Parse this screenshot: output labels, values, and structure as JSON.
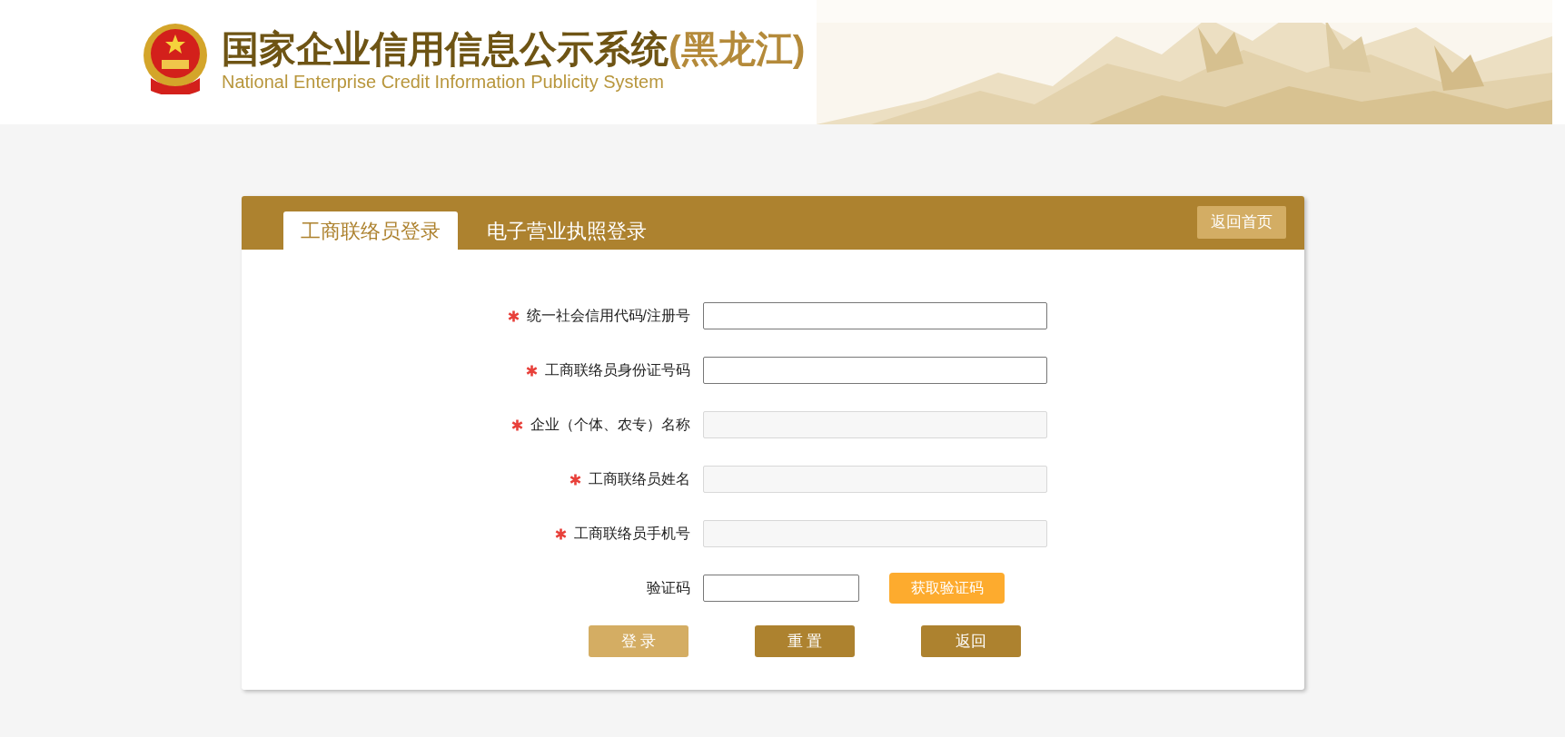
{
  "header": {
    "title": "国家企业信用信息公示系统",
    "title_suffix": "(黑龙江)",
    "subtitle": "National Enterprise Credit Information Publicity System"
  },
  "tabs": [
    {
      "label": "工商联络员登录",
      "selected": true
    },
    {
      "label": "电子营业执照登录",
      "selected": false
    }
  ],
  "home_button": "返回首页",
  "fields": [
    {
      "kind": "text",
      "label": "统一社会信用代码/注册号",
      "required": true,
      "disabled": false
    },
    {
      "kind": "text",
      "label": "工商联络员身份证号码",
      "required": true,
      "disabled": false
    },
    {
      "kind": "text",
      "label": "企业（个体、农专）名称",
      "required": true,
      "disabled": true
    },
    {
      "kind": "text",
      "label": "工商联络员姓名",
      "required": true,
      "disabled": true
    },
    {
      "kind": "text",
      "label": "工商联络员手机号",
      "required": true,
      "disabled": true
    },
    {
      "kind": "captcha",
      "label": "验证码",
      "required": false,
      "disabled": false,
      "button": "获取验证码"
    }
  ],
  "actions": [
    {
      "label": "登 录",
      "disabled": true
    },
    {
      "label": "重 置",
      "disabled": false
    },
    {
      "label": "返回",
      "disabled": false
    }
  ]
}
